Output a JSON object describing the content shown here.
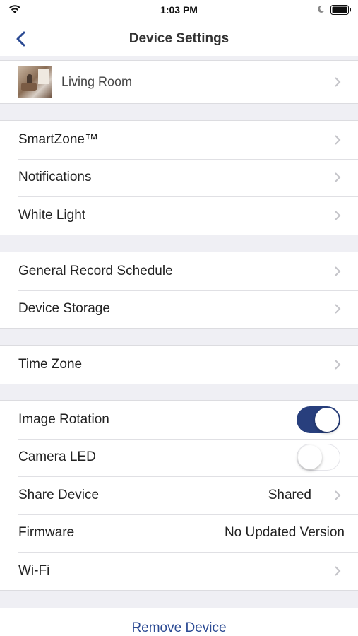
{
  "status_bar": {
    "time": "1:03 PM"
  },
  "header": {
    "title": "Device Settings",
    "back_icon": "chevron-left-icon"
  },
  "device": {
    "name": "Living Room"
  },
  "group1": [
    {
      "label": "SmartZone™"
    },
    {
      "label": "Notifications"
    },
    {
      "label": "White Light"
    }
  ],
  "group2": [
    {
      "label": "General Record Schedule"
    },
    {
      "label": "Device Storage"
    }
  ],
  "group3": [
    {
      "label": "Time Zone"
    }
  ],
  "group4": {
    "image_rotation": {
      "label": "Image Rotation",
      "enabled": true
    },
    "camera_led": {
      "label": "Camera LED",
      "enabled": false
    },
    "share_device": {
      "label": "Share Device",
      "value": "Shared"
    },
    "firmware": {
      "label": "Firmware",
      "value": "No Updated Version"
    },
    "wifi": {
      "label": "Wi-Fi"
    }
  },
  "footer": {
    "remove_label": "Remove Device"
  },
  "colors": {
    "accent": "#283f7d",
    "link": "#2b4a93",
    "background": "#efeff4"
  }
}
